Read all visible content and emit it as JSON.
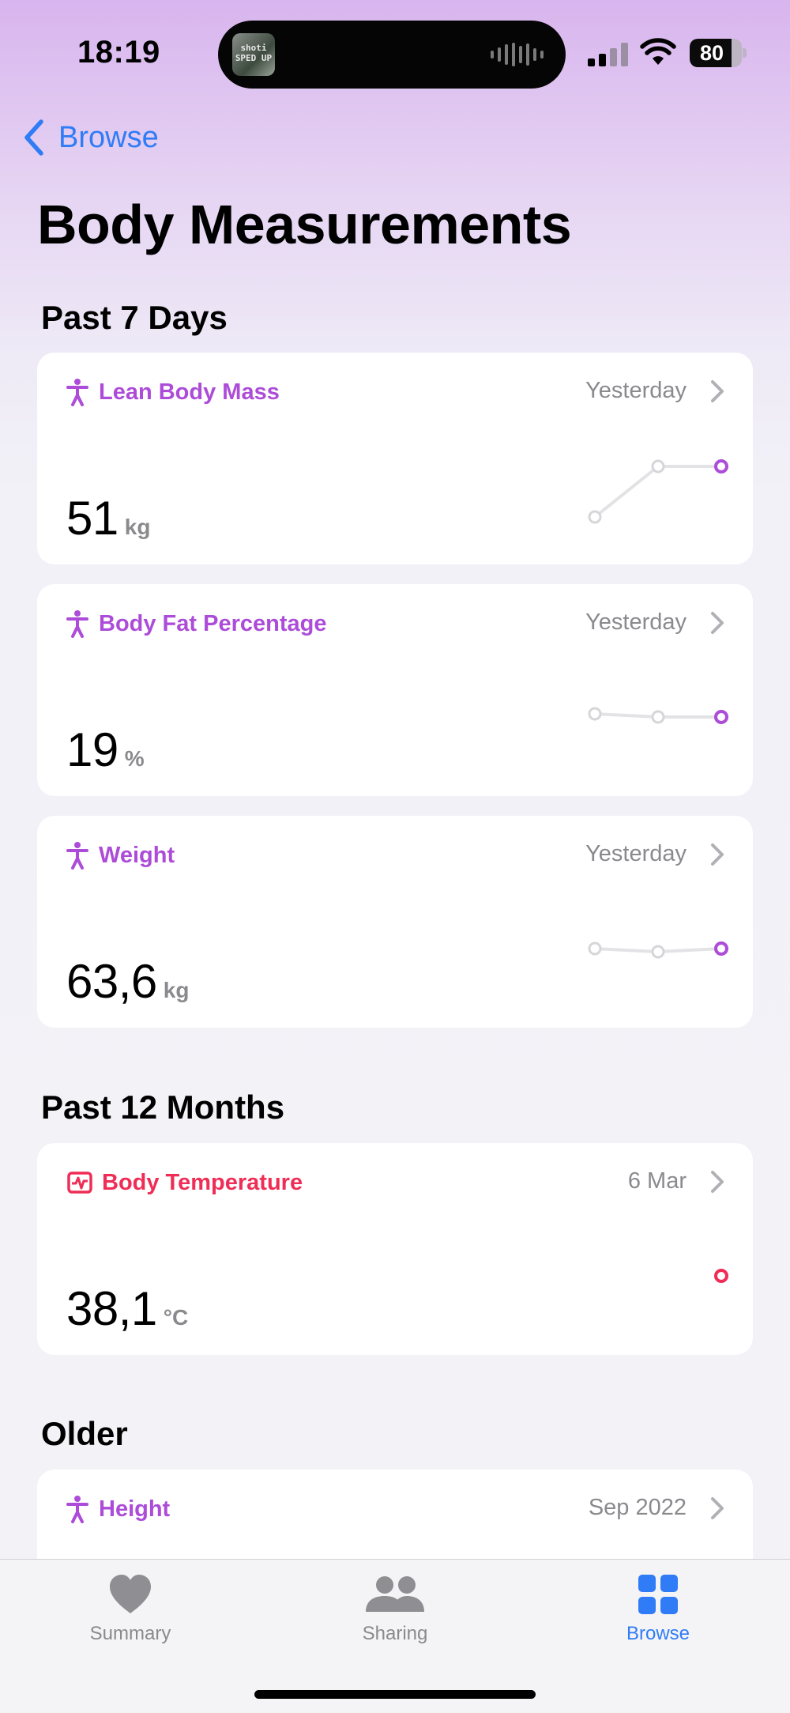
{
  "status_bar": {
    "time": "18:19",
    "battery": 80,
    "now_playing_art_text": "shoti SPED UP"
  },
  "nav": {
    "back_label": "Browse"
  },
  "page": {
    "title": "Body Measurements"
  },
  "sections": {
    "past7": "Past 7 Days",
    "past12": "Past 12 Months",
    "older": "Older"
  },
  "cards": [
    {
      "label": "Lean Body Mass",
      "date": "Yesterday",
      "value": "51",
      "unit": "kg",
      "accent": "#ac4cd8",
      "icon": "figure-icon",
      "trend": [
        0.0,
        0.8,
        0.8
      ]
    },
    {
      "label": "Body Fat Percentage",
      "date": "Yesterday",
      "value": "19",
      "unit": "%",
      "accent": "#ac4cd8",
      "icon": "figure-icon",
      "trend": [
        0.55,
        0.5,
        0.5
      ]
    },
    {
      "label": "Weight",
      "date": "Yesterday",
      "value": "63,6",
      "unit": "kg",
      "accent": "#ac4cd8",
      "icon": "figure-icon",
      "trend": [
        0.5,
        0.45,
        0.5
      ]
    },
    {
      "label": "Body Temperature",
      "date": "6 Mar",
      "value": "38,1",
      "unit": "°C",
      "accent": "#ef2d56",
      "icon": "thermometer-waveform-icon",
      "trend": [
        0.5
      ]
    },
    {
      "label": "Height",
      "date": "Sep 2022",
      "value": "",
      "unit": "",
      "accent": "#ac4cd8",
      "icon": "figure-icon",
      "trend": []
    }
  ],
  "tab_bar": {
    "summary": "Summary",
    "sharing": "Sharing",
    "browse": "Browse",
    "active": "browse"
  }
}
